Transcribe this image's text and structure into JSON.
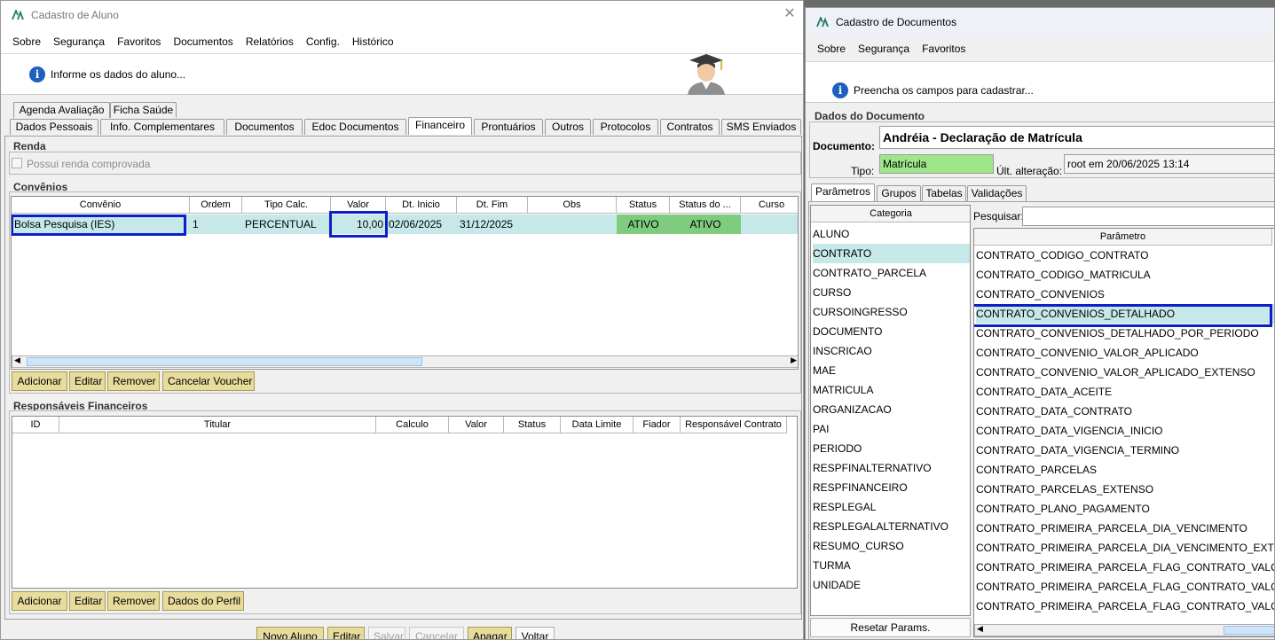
{
  "left": {
    "title": "Cadastro de Aluno",
    "menu": [
      "Sobre",
      "Segurança",
      "Favoritos",
      "Documentos",
      "Relatórios",
      "Config.",
      "Histórico"
    ],
    "info": "Informe os dados do aluno...",
    "tabs_row1": [
      "Agenda Avaliação",
      "Ficha Saúde"
    ],
    "tabs_row2": [
      "Dados Pessoais",
      "Info. Complementares",
      "Documentos",
      "Edoc Documentos",
      "Financeiro",
      "Prontuários",
      "Outros",
      "Protocolos",
      "Contratos",
      "SMS Enviados"
    ],
    "renda": {
      "title": "Renda",
      "checkbox_label": "Possui renda comprovada"
    },
    "convenios": {
      "title": "Convênios",
      "headers": [
        "Convênio",
        "Ordem",
        "Tipo Calc.",
        "Valor",
        "Dt. Inicio",
        "Dt. Fim",
        "Obs",
        "Status",
        "Status do ...",
        "Curso"
      ],
      "row": [
        "Bolsa Pesquisa (IES)",
        "1",
        "PERCENTUAL",
        "10,00",
        "02/06/2025",
        "31/12/2025",
        "",
        "ATIVO",
        "ATIVO",
        ""
      ],
      "buttons": [
        "Adicionar",
        "Editar",
        "Remover",
        "Cancelar Voucher"
      ]
    },
    "responsaveis": {
      "title": "Responsáveis Financeiros",
      "headers": [
        "ID",
        "Titular",
        "Calculo",
        "Valor",
        "Status",
        "Data Limite",
        "Fiador",
        "Responsável Contrato"
      ],
      "buttons": [
        "Adicionar",
        "Editar",
        "Remover",
        "Dados do Perfil"
      ]
    },
    "bottom_buttons": [
      "Novo Aluno",
      "Editar",
      "Salvar",
      "Cancelar",
      "Apagar",
      "Voltar"
    ]
  },
  "right": {
    "title": "Cadastro de Documentos",
    "menu": [
      "Sobre",
      "Segurança",
      "Favoritos"
    ],
    "info": "Preencha os campos para cadastrar...",
    "dados_title": "Dados do Documento",
    "documento_label": "Documento:",
    "documento_value": "Andréia - Declaração de Matrícula",
    "tipo_label": "Tipo:",
    "tipo_value": "Matrícula",
    "ult_label": "Últ. alteração:",
    "ult_value": "root em 20/06/2025 13:14",
    "tabs": [
      "Parâmetros",
      "Grupos",
      "Tabelas",
      "Validações"
    ],
    "categoria_header": "Categoria",
    "categorias": [
      "ALUNO",
      "CONTRATO",
      "CONTRATO_PARCELA",
      "CURSO",
      "CURSOINGRESSO",
      "DOCUMENTO",
      "INSCRICAO",
      "MAE",
      "MATRICULA",
      "ORGANIZACAO",
      "PAI",
      "PERIODO",
      "RESPFINALTERNATIVO",
      "RESPFINANCEIRO",
      "RESPLEGAL",
      "RESPLEGALALTERNATIVO",
      "RESUMO_CURSO",
      "TURMA",
      "UNIDADE"
    ],
    "pesquisar_label": "Pesquisar:",
    "parametro_header": "Parâmetro",
    "parametros": [
      "CONTRATO_CODIGO_CONTRATO",
      "CONTRATO_CODIGO_MATRICULA",
      "CONTRATO_CONVENIOS",
      "CONTRATO_CONVENIOS_DETALHADO",
      "CONTRATO_CONVENIOS_DETALHADO_POR_PERIODO",
      "CONTRATO_CONVENIO_VALOR_APLICADO",
      "CONTRATO_CONVENIO_VALOR_APLICADO_EXTENSO",
      "CONTRATO_DATA_ACEITE",
      "CONTRATO_DATA_CONTRATO",
      "CONTRATO_DATA_VIGENCIA_INICIO",
      "CONTRATO_DATA_VIGENCIA_TERMINO",
      "CONTRATO_PARCELAS",
      "CONTRATO_PARCELAS_EXTENSO",
      "CONTRATO_PLANO_PAGAMENTO",
      "CONTRATO_PRIMEIRA_PARCELA_DIA_VENCIMENTO",
      "CONTRATO_PRIMEIRA_PARCELA_DIA_VENCIMENTO_EXTENSO",
      "CONTRATO_PRIMEIRA_PARCELA_FLAG_CONTRATO_VALOR",
      "CONTRATO_PRIMEIRA_PARCELA_FLAG_CONTRATO_VALOR_...",
      "CONTRATO_PRIMEIRA_PARCELA_FLAG_CONTRATO_VALOR_..."
    ],
    "reset_button": "Resetar Params."
  },
  "colors": {
    "selection": "#c6e8e8",
    "status_green": "#7fcc7f",
    "tipo_green": "#9ee68a",
    "highlight": "#0d1fc8",
    "button": "#e8dc9c"
  }
}
